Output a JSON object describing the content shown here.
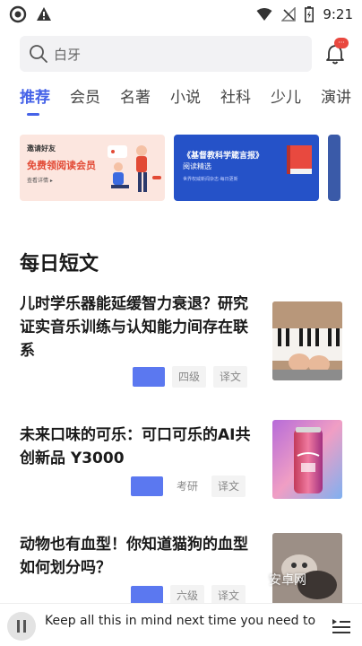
{
  "status": {
    "time": "9:21"
  },
  "search": {
    "placeholder": "白牙"
  },
  "notifications": {
    "badge": "···"
  },
  "tabs": [
    {
      "label": "推荐"
    },
    {
      "label": "会员"
    },
    {
      "label": "名著"
    },
    {
      "label": "小说"
    },
    {
      "label": "社科"
    },
    {
      "label": "少儿"
    },
    {
      "label": "演讲"
    }
  ],
  "banners": [
    {
      "tag": "邀请好友",
      "title": "免费领阅读会员",
      "sub": "查看详情 ▸"
    },
    {
      "title": "《基督教科学箴言报》",
      "sub": "阅读精选",
      "tiny": "世界权威新闻杂志·每日更新"
    }
  ],
  "section": {
    "title": "每日短文"
  },
  "articles": [
    {
      "title": "儿时学乐器能延缓智力衰退？研究证实音乐训练与认知能力间存在联系",
      "level": "四级",
      "translate": "译文"
    },
    {
      "title": "未来口味的可乐：可口可乐的AI共创新品 Y3000",
      "level": "考研",
      "translate": "译文"
    },
    {
      "title": "动物也有血型！你知道猫狗的血型如何划分吗？",
      "level": "六级",
      "translate": "译文"
    }
  ],
  "watermark": "安卓网",
  "player": {
    "text": "Keep all this in mind next time you need to g"
  },
  "colors": {
    "accent": "#4663e8",
    "tag_block": "#5b78f0",
    "badge": "#e9483f"
  }
}
